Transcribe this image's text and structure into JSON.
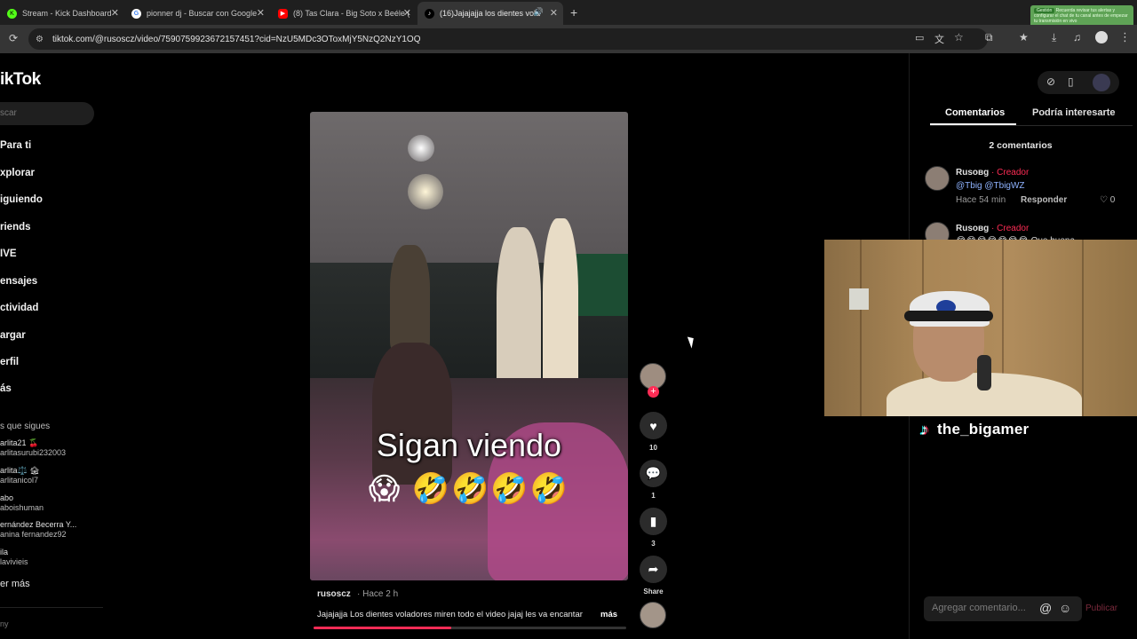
{
  "browser": {
    "tabs": [
      {
        "title": "Stream - Kick Dashboard",
        "icon": "kick-icon"
      },
      {
        "title": "pionner dj - Buscar con Google",
        "icon": "google-icon"
      },
      {
        "title": "(8) Tas Clara - Big Soto x Beéle (",
        "icon": "youtube-icon"
      },
      {
        "title": "(16)Jajajajja los dientes vola",
        "icon": "tiktok-icon"
      }
    ],
    "new_tab": "+",
    "url": "tiktok.com/@ruso­scz/video/7590759923672157451?cid=NzU5MDc3OToxMjY5NzQ2NzY1OQ",
    "notification_badge": "Gestión",
    "notification_text": "Recuerda revisar tus alertas y configurar el chat de tu canal antes de empezar tu transmisión en vivo"
  },
  "sidebar": {
    "logo": "ikTok",
    "search_placeholder": "scar",
    "nav": [
      "Para ti",
      "xplorar",
      "iguiendo",
      "riends",
      "IVE",
      "ensajes",
      "ctividad",
      "argar",
      "erfil",
      "ás"
    ],
    "following_title": "s que sigues",
    "accounts": [
      {
        "name": "arlita21 🍒",
        "user": "arlitasurubi232003"
      },
      {
        "name": "arlita⚖️ 🏚",
        "user": "arlitanicol7"
      },
      {
        "name": "abo",
        "user": "aboishuman"
      },
      {
        "name": "ernández Becerra Y...",
        "user": "anina fernandez92"
      },
      {
        "name": "ila",
        "user": "lavivieis"
      }
    ],
    "see_more": "er más",
    "footer": "ny"
  },
  "video": {
    "overlay_caption": "Sigan viendo",
    "overlay_emojis": "😱 🤣🤣🤣🤣",
    "author": "rusoscz",
    "time": "Hace 2 h",
    "description": "Jajajajja Los dientes voladores miren todo el video jajaj les va encantar",
    "more": "más",
    "progress": 0.44
  },
  "actions": {
    "likes": "10",
    "comments": "1",
    "saves": "3",
    "share_label": "Share"
  },
  "panel": {
    "tab_comments": "Comentarios",
    "tab_interest": "Podría interesarte",
    "comment_count": "2 comentarios",
    "comments": [
      {
        "name": "Rusoвg",
        "badge": "· Creador",
        "text": "@Tbig @TbigWZ",
        "time": "Hace 54 min",
        "reply": "Responder",
        "likes": "0"
      },
      {
        "name": "Rusoвg",
        "badge": "· Creador",
        "text": "😂😂😂😂😂😂😂 Que buena",
        "time": "",
        "reply": "",
        "likes": ""
      }
    ],
    "input_placeholder": "Agregar comentario...",
    "publish": "Publicar"
  },
  "stream": {
    "streamer_name": "the_bigamer"
  },
  "colors": {
    "accent": "#fe2c55",
    "background": "#000000",
    "panel_bg": "#1e1e1e"
  }
}
